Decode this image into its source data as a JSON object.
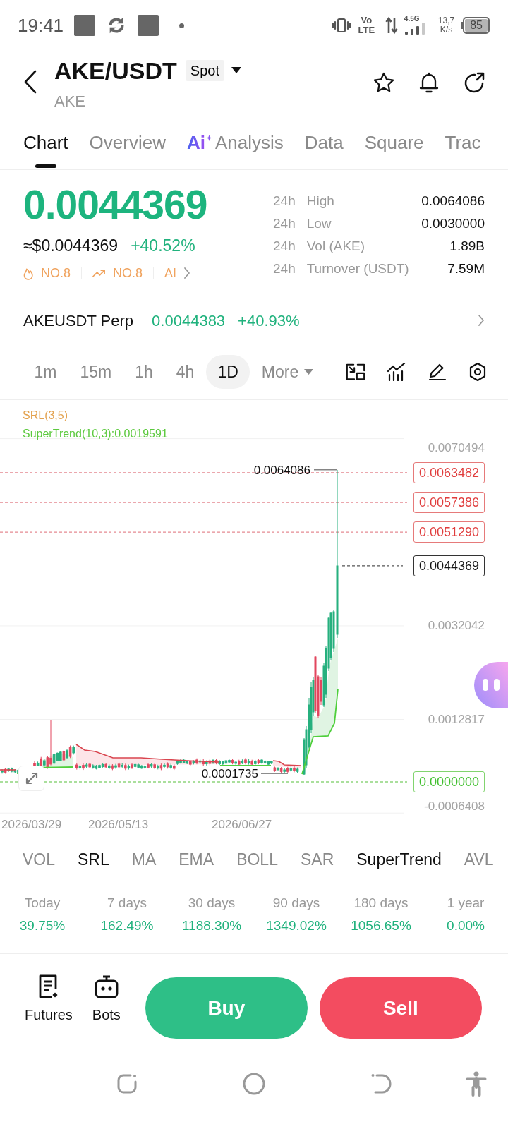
{
  "status_bar": {
    "time": "19:41",
    "volte": "Vo LTE",
    "network_type": "4.5G",
    "data_speed": "13,7",
    "data_speed_unit": "K/s",
    "battery": "85"
  },
  "header": {
    "title": "AKE/USDT",
    "market_type": "Spot",
    "subtitle": "AKE"
  },
  "tabs": [
    {
      "label": "Chart",
      "selected": true
    },
    {
      "label": "Overview",
      "selected": false
    },
    {
      "label": "Analysis",
      "prefix": "Ai",
      "selected": false
    },
    {
      "label": "Data",
      "selected": false
    },
    {
      "label": "Square",
      "selected": false
    },
    {
      "label": "Trac",
      "selected": false
    }
  ],
  "ticker": {
    "last_price": "0.0044369",
    "fiat_price": "≈$0.0044369",
    "change": "+40.52%",
    "rankings": [
      {
        "kind": "hot",
        "label": "NO.8"
      },
      {
        "kind": "trend",
        "label": "NO.8"
      },
      {
        "kind": "ai",
        "label": "AI"
      }
    ],
    "stats": [
      {
        "period": "24h",
        "label": "High",
        "value": "0.0064086"
      },
      {
        "period": "24h",
        "label": "Low",
        "value": "0.0030000"
      },
      {
        "period": "24h",
        "label": "Vol (AKE)",
        "value": "1.89B"
      },
      {
        "period": "24h",
        "label": "Turnover (USDT)",
        "value": "7.59M"
      }
    ]
  },
  "perp": {
    "name": "AKEUSDT Perp",
    "price": "0.0044383",
    "change": "+40.93%"
  },
  "timeframes": [
    {
      "label": "1m",
      "selected": false
    },
    {
      "label": "15m",
      "selected": false
    },
    {
      "label": "1h",
      "selected": false
    },
    {
      "label": "4h",
      "selected": false
    },
    {
      "label": "1D",
      "selected": true
    }
  ],
  "more_menu": {
    "label": "More"
  },
  "chart": {
    "legend": [
      {
        "label": "SRL(3,5)",
        "color": "#e3a24f"
      },
      {
        "label": "SuperTrend(10,3):0.0019591",
        "color": "#5cc93e"
      }
    ],
    "y_axis_labels": [
      "0.0070494",
      "0.0032042",
      "0.0012817",
      "-0.0006408"
    ],
    "price_levels": [
      {
        "kind": "resistance",
        "label": "0.0063482"
      },
      {
        "kind": "resistance",
        "label": "0.0057386"
      },
      {
        "kind": "resistance",
        "label": "0.0051290"
      },
      {
        "kind": "last",
        "label": "0.0044369"
      },
      {
        "kind": "support",
        "label": "0.0000000"
      }
    ],
    "annotations": [
      {
        "kind": "high",
        "label": "0.0064086"
      },
      {
        "kind": "low",
        "label": "0.0001735"
      }
    ],
    "x_axis_labels": [
      "2026/03/29",
      "2026/05/13",
      "2026/06/27"
    ]
  },
  "indicators": [
    {
      "label": "VOL",
      "selected": false
    },
    {
      "label": "SRL",
      "selected": true
    },
    {
      "label": "MA",
      "selected": false
    },
    {
      "label": "EMA",
      "selected": false
    },
    {
      "label": "BOLL",
      "selected": false
    },
    {
      "label": "SAR",
      "selected": false
    },
    {
      "label": "SuperTrend",
      "selected": true
    },
    {
      "label": "AVL",
      "selected": false
    }
  ],
  "returns": [
    {
      "period": "Today",
      "value": "39.75%"
    },
    {
      "period": "7 days",
      "value": "162.49%"
    },
    {
      "period": "30 days",
      "value": "1188.30%"
    },
    {
      "period": "90 days",
      "value": "1349.02%"
    },
    {
      "period": "180 days",
      "value": "1056.65%"
    },
    {
      "period": "1 year",
      "value": "0.00%"
    }
  ],
  "actions": {
    "shortcuts": [
      {
        "kind": "futures",
        "label": "Futures"
      },
      {
        "kind": "bots",
        "label": "Bots"
      }
    ],
    "buy": "Buy",
    "sell": "Sell"
  }
}
